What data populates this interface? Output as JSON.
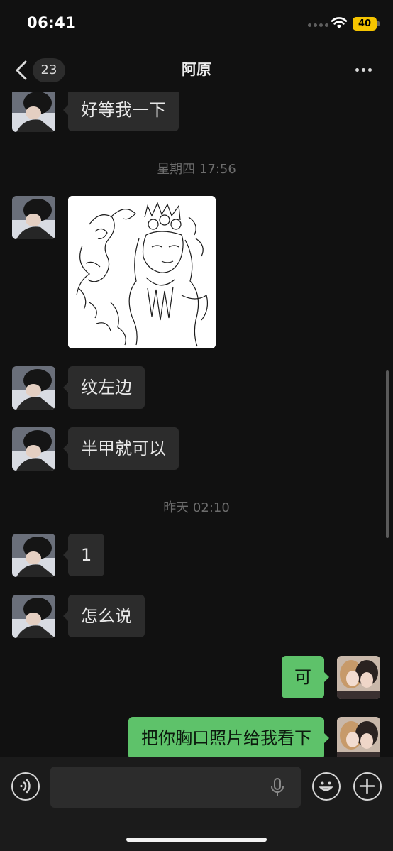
{
  "status_bar": {
    "time": "06:41",
    "battery": "40"
  },
  "nav": {
    "unread_count": "23",
    "title": "阿原"
  },
  "messages": [
    {
      "kind": "text",
      "side": "left",
      "text": "好等我一下"
    },
    {
      "kind": "time",
      "text": "星期四 17:56"
    },
    {
      "kind": "image",
      "side": "left",
      "description_icon": "tattoo-sketch-image"
    },
    {
      "kind": "text",
      "side": "left",
      "text": "纹左边"
    },
    {
      "kind": "text",
      "side": "left",
      "text": "半甲就可以"
    },
    {
      "kind": "time",
      "text": "昨天 02:10"
    },
    {
      "kind": "text",
      "side": "left",
      "text": "1"
    },
    {
      "kind": "text",
      "side": "left",
      "text": "怎么说"
    },
    {
      "kind": "text",
      "side": "right",
      "text": "可"
    },
    {
      "kind": "text",
      "side": "right",
      "text": "把你胸口照片给我看下"
    }
  ],
  "input_bar": {
    "placeholder": "",
    "value": ""
  },
  "icons": [
    "back-chevron-icon",
    "more-icon",
    "voice-icon",
    "microphone-icon",
    "emoji-icon",
    "plus-icon",
    "wifi-icon",
    "battery-icon"
  ],
  "colors": {
    "background": "#111111",
    "incoming_bubble": "#2c2c2c",
    "outgoing_bubble": "#5ec26a",
    "battery": "#f5c400"
  }
}
